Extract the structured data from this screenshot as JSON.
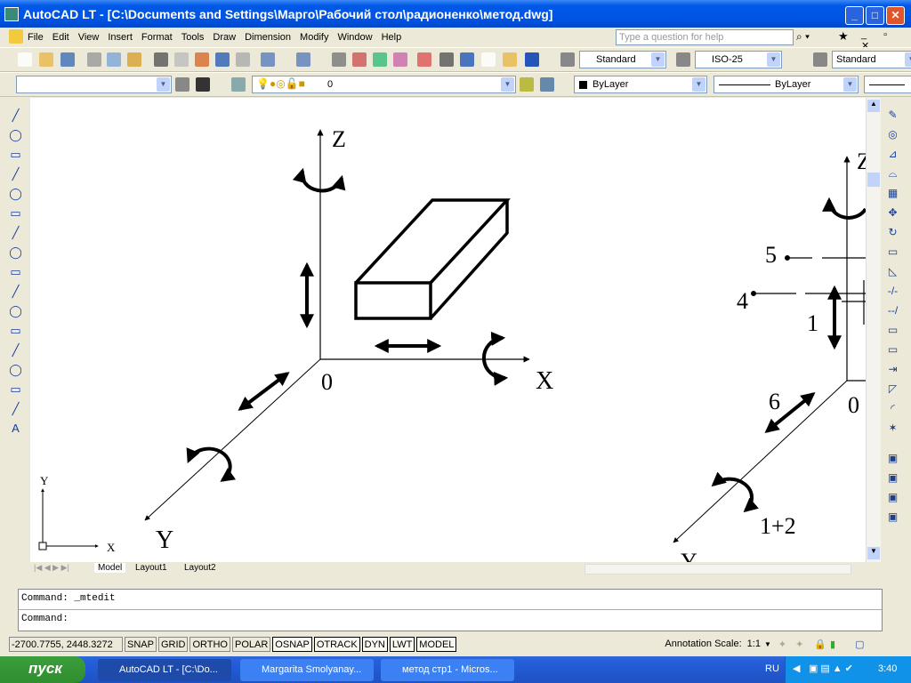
{
  "window": {
    "title": "AutoCAD LT - [C:\\Documents and Settings\\Марго\\Рабочий стол\\радионенко\\метод.dwg]",
    "minimize": "_",
    "maximize": "□",
    "close": "✕"
  },
  "menu": [
    "File",
    "Edit",
    "View",
    "Insert",
    "Format",
    "Tools",
    "Draw",
    "Dimension",
    "Modify",
    "Window",
    "Help"
  ],
  "help": {
    "placeholder": "Type a question for help"
  },
  "styles": {
    "text_style": "Standard",
    "dim_style": "ISO-25",
    "table_style": "Standard"
  },
  "layers": {
    "workspace": "",
    "current_layer": "0",
    "color": "ByLayer",
    "linetype": "ByLayer"
  },
  "drawing": {
    "left": {
      "z": "Z",
      "x": "X",
      "y": "Y",
      "origin": "0"
    },
    "right": {
      "z": "Z",
      "y": "Y",
      "origin": "0",
      "labels": [
        "5",
        "4",
        "1",
        "6",
        "1+2"
      ]
    },
    "ucs": {
      "x": "X",
      "y": "Y"
    }
  },
  "tabs": [
    "Model",
    "Layout1",
    "Layout2"
  ],
  "command": {
    "history": "Command:  _mtedit",
    "prompt": "Command:"
  },
  "status": {
    "coords": "-2700.7755, 2448.3272",
    "toggles": [
      {
        "label": "SNAP",
        "on": false
      },
      {
        "label": "GRID",
        "on": false
      },
      {
        "label": "ORTHO",
        "on": false
      },
      {
        "label": "POLAR",
        "on": false
      },
      {
        "label": "OSNAP",
        "on": true
      },
      {
        "label": "OTRACK",
        "on": true
      },
      {
        "label": "DYN",
        "on": true
      },
      {
        "label": "LWT",
        "on": true
      },
      {
        "label": "MODEL",
        "on": true
      }
    ],
    "annotation_scale_label": "Annotation Scale:",
    "annotation_scale": "1:1"
  },
  "taskbar": {
    "start": "пуск",
    "tasks": [
      "AutoCAD LT - [C:\\Do...",
      "Margarita Smolyanay...",
      "метод  стр1 - Micros..."
    ],
    "lang": "RU",
    "clock": "3:40"
  }
}
